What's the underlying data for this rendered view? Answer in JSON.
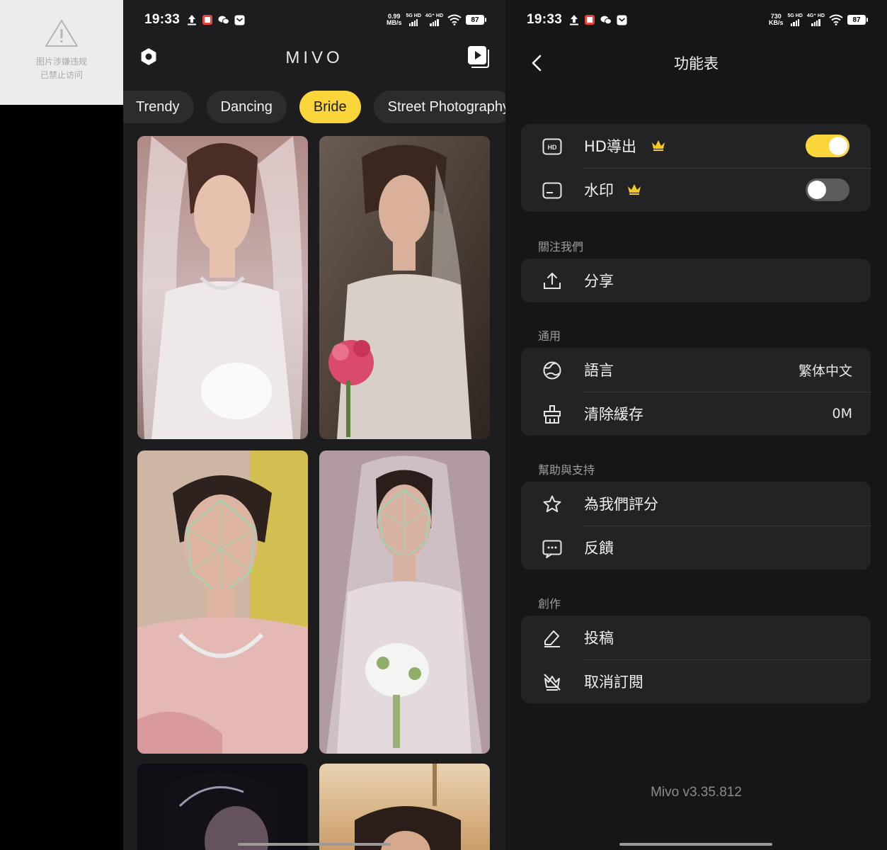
{
  "blocked": {
    "line1": "图片涉嫌违规",
    "line2": "已禁止访问"
  },
  "status_mid": {
    "time": "19:33",
    "speed_value": "0.99",
    "speed_unit": "MB/s",
    "net1": "5G HD",
    "net2": "4G⁺ HD",
    "battery": "87"
  },
  "status_right": {
    "time": "19:33",
    "speed_value": "730",
    "speed_unit": "KB/s",
    "net1": "5G HD",
    "net2": "4G⁺ HD",
    "battery": "87"
  },
  "mid": {
    "title": "MIVO",
    "tabs": [
      {
        "label": "Trendy",
        "active": false
      },
      {
        "label": "Dancing",
        "active": false
      },
      {
        "label": "Bride",
        "active": true
      },
      {
        "label": "Street Photography",
        "active": false
      }
    ]
  },
  "right": {
    "title": "功能表",
    "hd_export": {
      "label": "HD導出",
      "toggle_on": true
    },
    "watermark": {
      "label": "水印",
      "toggle_on": false
    },
    "section_follow": "關注我們",
    "share": "分享",
    "section_general": "通用",
    "language": {
      "label": "語言",
      "value": "繁体中文"
    },
    "clear_cache": {
      "label": "清除緩存",
      "value": "0M"
    },
    "section_help": "幫助與支持",
    "rate": "為我們評分",
    "feedback": "反饋",
    "section_create": "創作",
    "submit": "投稿",
    "unsubscribe": "取消訂閱",
    "version": "Mivo v3.35.812"
  },
  "colors": {
    "accent": "#fad63a",
    "background": "#161617",
    "card": "#232325"
  }
}
